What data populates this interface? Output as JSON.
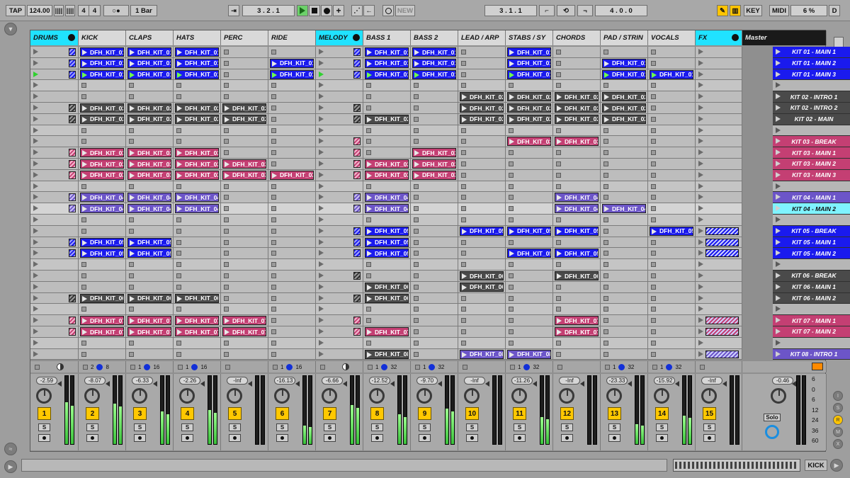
{
  "transport": {
    "tap": "TAP",
    "tempo": "124.00",
    "nudge": "||||",
    "signature_num": "4",
    "signature_den": "4",
    "metro": "○●",
    "quantize": "1 Bar",
    "position": "3 .   2 .   1",
    "new": "NEW",
    "loop_start": "3 .   1 .   1",
    "loop_len": "4 .   0 .   0",
    "key": "KEY",
    "midi": "MIDI",
    "cpu": "6 %",
    "disk": "D"
  },
  "tracks": [
    {
      "name": "DRUMS",
      "type": "group",
      "color": "#20e2ff"
    },
    {
      "name": "KICK",
      "type": "track"
    },
    {
      "name": "CLAPS",
      "type": "track"
    },
    {
      "name": "HATS",
      "type": "track"
    },
    {
      "name": "PERC",
      "type": "track"
    },
    {
      "name": "RIDE",
      "type": "track"
    },
    {
      "name": "MELODY",
      "type": "group",
      "color": "#20e2ff"
    },
    {
      "name": "BASS 1",
      "type": "track"
    },
    {
      "name": "BASS 2",
      "type": "track"
    },
    {
      "name": "LEAD / ARP",
      "type": "track"
    },
    {
      "name": "STABS / SY",
      "type": "track"
    },
    {
      "name": "CHORDS",
      "type": "track"
    },
    {
      "name": "PAD / STRIN",
      "type": "track"
    },
    {
      "name": "VOCALS",
      "type": "track"
    },
    {
      "name": "FX",
      "type": "group",
      "color": "#20e2ff"
    },
    {
      "name": "Master",
      "type": "master"
    }
  ],
  "clips": [
    [
      "hb",
      "b",
      "b",
      "b",
      "",
      "",
      "hb",
      "b",
      "b",
      "",
      "b",
      "",
      "",
      "",
      "",
      ""
    ],
    [
      "hb",
      "b",
      "b",
      "b",
      "",
      "b",
      "hb",
      "b",
      "b",
      "",
      "b",
      "",
      "b",
      "",
      "",
      ""
    ],
    [
      "hb",
      "B",
      "B",
      "B",
      "",
      "B",
      "hb",
      "B",
      "B",
      "",
      "B",
      "",
      "B",
      "B",
      "",
      ""
    ],
    [
      "",
      "",
      "",
      "",
      "",
      "",
      "",
      "",
      "",
      "",
      "",
      "",
      "",
      "",
      "",
      ""
    ],
    [
      "",
      "",
      "",
      "",
      "",
      "",
      "",
      "",
      "",
      "g",
      "g",
      "g",
      "g",
      "",
      "",
      ""
    ],
    [
      "hg",
      "g",
      "g",
      "g",
      "g",
      "",
      "hg",
      "",
      "",
      "g",
      "g",
      "g",
      "g",
      "",
      "",
      ""
    ],
    [
      "hg",
      "g",
      "g",
      "g",
      "g",
      "",
      "hg",
      "g",
      "",
      "g",
      "g",
      "g",
      "g",
      "",
      "",
      ""
    ],
    [
      "",
      "",
      "",
      "",
      "",
      "",
      "",
      "",
      "",
      "",
      "",
      "",
      "",
      "",
      "",
      ""
    ],
    [
      "",
      "",
      "",
      "",
      "",
      "",
      "hp",
      "",
      "",
      "",
      "p",
      "p",
      "",
      "",
      "",
      ""
    ],
    [
      "hp",
      "p",
      "p",
      "p",
      "",
      "",
      "hp",
      "",
      "p",
      "",
      "",
      "",
      "",
      "",
      "",
      ""
    ],
    [
      "hp",
      "p",
      "p",
      "p",
      "p",
      "",
      "hp",
      "p",
      "p",
      "",
      "",
      "",
      "",
      "",
      "",
      ""
    ],
    [
      "hp",
      "p",
      "p",
      "p",
      "p",
      "p",
      "hp",
      "p",
      "p",
      "",
      "",
      "",
      "",
      "",
      "",
      ""
    ],
    [
      "",
      "",
      "",
      "",
      "",
      "",
      "",
      "",
      "",
      "",
      "",
      "",
      "",
      "",
      "",
      ""
    ],
    [
      "hu",
      "u",
      "u",
      "u",
      "",
      "",
      "hu",
      "u",
      "",
      "",
      "",
      "u",
      "",
      "",
      "",
      ""
    ],
    [
      "hu",
      "u",
      "u",
      "u",
      "",
      "",
      "hu",
      "u",
      "",
      "",
      "",
      "u",
      "u",
      "",
      "",
      ""
    ],
    [
      "",
      "",
      "",
      "",
      "",
      "",
      "",
      "",
      "",
      "",
      "",
      "",
      "",
      "",
      "",
      ""
    ],
    [
      "",
      "",
      "",
      "",
      "",
      "",
      "hb",
      "b",
      "",
      "b",
      "b",
      "b",
      "",
      "b",
      "fb",
      ""
    ],
    [
      "hb",
      "b",
      "b",
      "",
      "",
      "",
      "hb",
      "b",
      "",
      "",
      "",
      "",
      "",
      "",
      "fb",
      ""
    ],
    [
      "hb",
      "b",
      "b",
      "",
      "",
      "",
      "hb",
      "b",
      "",
      "",
      "b",
      "b",
      "",
      "",
      "fb",
      ""
    ],
    [
      "",
      "",
      "",
      "",
      "",
      "",
      "",
      "",
      "",
      "",
      "",
      "",
      "",
      "",
      "",
      ""
    ],
    [
      "",
      "",
      "",
      "",
      "",
      "",
      "hg",
      "",
      "",
      "g",
      "",
      "g",
      "",
      "",
      "",
      ""
    ],
    [
      "",
      "",
      "",
      "",
      "",
      "",
      "",
      "g",
      "",
      "g",
      "",
      "",
      "",
      "",
      "",
      ""
    ],
    [
      "hg",
      "g",
      "g",
      "g",
      "",
      "",
      "hg",
      "g",
      "",
      "",
      "",
      "",
      "",
      "",
      "",
      ""
    ],
    [
      "",
      "",
      "",
      "",
      "",
      "",
      "",
      "",
      "",
      "",
      "",
      "",
      "",
      "",
      "",
      ""
    ],
    [
      "hp",
      "p",
      "p",
      "p",
      "p",
      "",
      "hp",
      "",
      "",
      "",
      "",
      "p",
      "",
      "",
      "fp",
      ""
    ],
    [
      "hp",
      "p",
      "p",
      "p",
      "p",
      "",
      "hp",
      "p",
      "",
      "",
      "",
      "p",
      "",
      "",
      "fp",
      ""
    ],
    [
      "",
      "",
      "",
      "",
      "",
      "",
      "",
      "",
      "",
      "",
      "",
      "",
      "",
      "",
      "",
      ""
    ],
    [
      "",
      "",
      "",
      "",
      "",
      "",
      "",
      "g",
      "",
      "u",
      "u",
      "",
      "",
      "",
      "fu",
      ""
    ]
  ],
  "clip_labels": {
    "1": "DFH_KIT_01",
    "2": "DFH_KIT_02",
    "3": "DFH_KIT_03",
    "4": "DFH_KIT_04",
    "5": "DFH_KIT_05",
    "6": "DFH_KIT_06",
    "7": "DFH_KIT_07",
    "8": "DFH_KIT_08"
  },
  "scenes": [
    {
      "name": "KIT 01 - MAIN 1",
      "color": "#1a1aee"
    },
    {
      "name": "KIT 01 - MAIN 2",
      "color": "#1a1aee"
    },
    {
      "name": "KIT 01 - MAIN 3",
      "color": "#1a1aee"
    },
    {
      "name": "",
      "color": ""
    },
    {
      "name": "KIT 02 - INTRO 1",
      "color": "#4a4a4a"
    },
    {
      "name": "KIT 02 - INTRO 2",
      "color": "#4a4a4a"
    },
    {
      "name": "KIT 02 - MAIN",
      "color": "#4a4a4a"
    },
    {
      "name": "",
      "color": ""
    },
    {
      "name": "KIT 03 - BREAK",
      "color": "#c43f73"
    },
    {
      "name": "KIT 03 - MAIN 1",
      "color": "#c43f73"
    },
    {
      "name": "KIT 03 - MAIN 2",
      "color": "#c43f73"
    },
    {
      "name": "KIT 03 - MAIN 3",
      "color": "#c43f73"
    },
    {
      "name": "",
      "color": ""
    },
    {
      "name": "KIT 04 - MAIN 1",
      "color": "#6c55c8"
    },
    {
      "name": "KIT 04 - MAIN 2",
      "color": "#7ff3ff"
    },
    {
      "name": "",
      "color": ""
    },
    {
      "name": "KIT 05 - BREAK",
      "color": "#1a1aee"
    },
    {
      "name": "KIT 05 - MAIN 1",
      "color": "#1a1aee"
    },
    {
      "name": "KIT 05 - MAIN 2",
      "color": "#1a1aee"
    },
    {
      "name": "",
      "color": ""
    },
    {
      "name": "KIT 06 - BREAK",
      "color": "#4a4a4a"
    },
    {
      "name": "KIT 06 - MAIN 1",
      "color": "#4a4a4a"
    },
    {
      "name": "KIT 06 - MAIN 2",
      "color": "#4a4a4a"
    },
    {
      "name": "",
      "color": ""
    },
    {
      "name": "KIT 07 - MAIN 1",
      "color": "#c43f73"
    },
    {
      "name": "KIT 07 - MAIN 2",
      "color": "#c43f73"
    },
    {
      "name": "",
      "color": ""
    },
    {
      "name": "KIT 08 - INTRO 1",
      "color": "#6c55c8"
    }
  ],
  "io": [
    "",
    "2  8",
    "1  16",
    "1  16",
    "",
    "1  16",
    "",
    "1  32",
    "1  32",
    "",
    "1  32",
    "",
    "1  32",
    "1  32",
    "",
    ""
  ],
  "volumes": [
    "-2.59",
    "-8.07",
    "-6.33",
    "-2.26",
    "-Inf",
    "-16.13",
    "-6.66",
    "-12.52",
    "-9.70",
    "-Inf",
    "-11.26",
    "-Inf",
    "-23.33",
    "-15.92",
    "-Inf",
    "-0.46"
  ],
  "meter_levels": [
    0.62,
    0.6,
    0.48,
    0.5,
    0.0,
    0.28,
    0.58,
    0.44,
    0.52,
    0.0,
    0.4,
    0.0,
    0.3,
    0.42,
    0.0,
    0.0
  ],
  "track_numbers": [
    "1",
    "2",
    "3",
    "4",
    "5",
    "6",
    "7",
    "8",
    "9",
    "10",
    "11",
    "12",
    "13",
    "14",
    "15",
    ""
  ],
  "solo_label": "S",
  "master_solo": "Solo",
  "db_scale": [
    "6",
    "0",
    "6",
    "12",
    "24",
    "36",
    "60"
  ],
  "status_track": "KICK"
}
